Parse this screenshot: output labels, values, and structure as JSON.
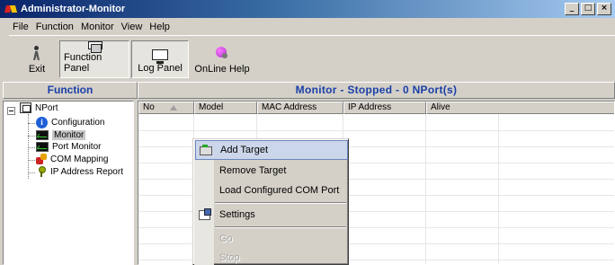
{
  "window": {
    "title": "Administrator-Monitor",
    "controls": [
      "_",
      "□",
      "×"
    ]
  },
  "menubar": {
    "items": [
      {
        "label": "File",
        "mnemonic": "F"
      },
      {
        "label": "Function",
        "mnemonic": ""
      },
      {
        "label": "Monitor",
        "mnemonic": ""
      },
      {
        "label": "View",
        "mnemonic": ""
      },
      {
        "label": "Help",
        "mnemonic": "H"
      }
    ]
  },
  "toolbar": {
    "buttons": [
      {
        "label": "Exit",
        "icon": "exit-icon"
      },
      {
        "label": "Function Panel",
        "icon": "function-panel-icon",
        "pressed": true
      },
      {
        "label": "Log Panel",
        "icon": "log-panel-icon",
        "pressed": true
      },
      {
        "label": "OnLine Help",
        "icon": "online-help-icon"
      }
    ]
  },
  "function_panel": {
    "header": "Function",
    "tree": {
      "root": {
        "label": "NPort",
        "icon": "nport-icon",
        "expanded": true
      },
      "children": [
        {
          "label": "Configuration",
          "icon": "info-icon"
        },
        {
          "label": "Monitor",
          "icon": "monitor-icon",
          "selected": true
        },
        {
          "label": "Port Monitor",
          "icon": "monitor-icon"
        },
        {
          "label": "COM Mapping",
          "icon": "com-mapping-icon"
        },
        {
          "label": "IP Address Report",
          "icon": "ip-report-icon"
        }
      ]
    }
  },
  "monitor_panel": {
    "header": "Monitor - Stopped - 0 NPort(s)",
    "columns": [
      "No",
      "Model",
      "MAC Address",
      "IP Address",
      "Alive"
    ],
    "rows": []
  },
  "context_menu": {
    "items": [
      {
        "label": "Add Target",
        "icon": "add-target-icon",
        "highlighted": true,
        "enabled": true
      },
      {
        "label": "Remove Target",
        "enabled": true
      },
      {
        "label": "Load Configured COM Port",
        "enabled": true
      },
      {
        "label": "Settings",
        "icon": "settings-icon",
        "enabled": true
      },
      {
        "label": "Go",
        "enabled": false
      },
      {
        "label": "Stop",
        "enabled": false
      }
    ]
  },
  "colors": {
    "titlebar_start": "#0a246a",
    "titlebar_end": "#a6caf0",
    "header_text": "#1a3fa8",
    "menu_highlight": "#ccd6ea"
  }
}
